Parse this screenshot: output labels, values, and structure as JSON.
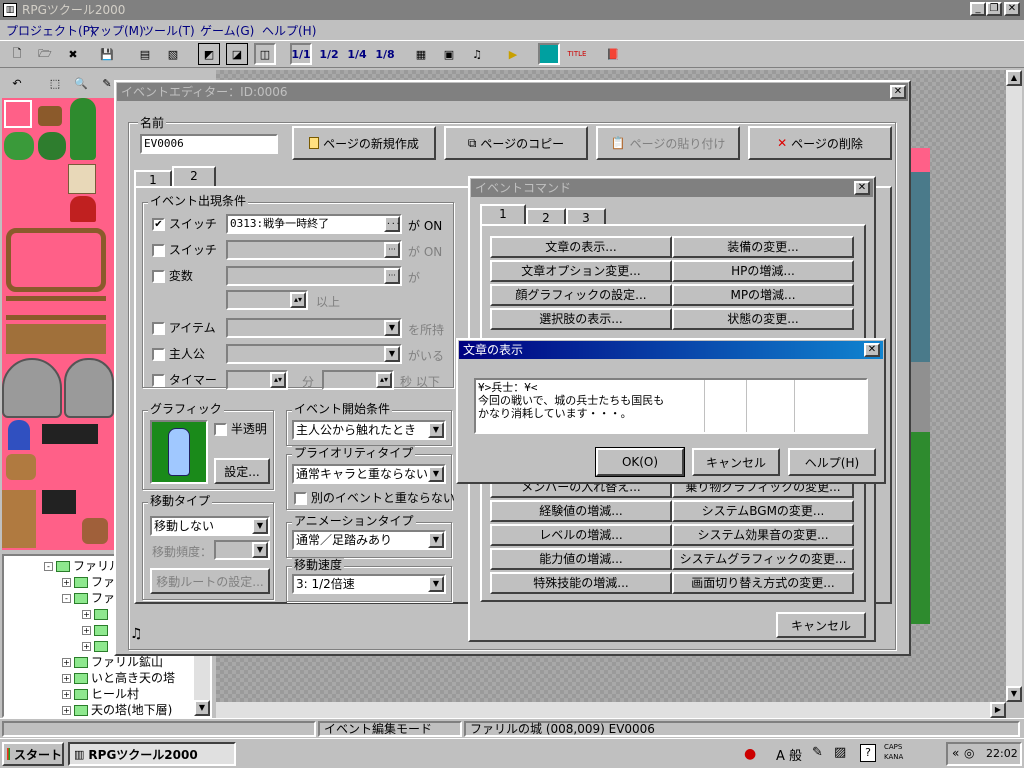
{
  "app": {
    "title": "RPGツクール2000",
    "menu": [
      "プロジェクト(P)",
      "マップ(M)",
      "ツール(T)",
      "ゲーム(G)",
      "ヘルプ(H)"
    ],
    "layer_buttons": [
      "1/1",
      "1/2",
      "1/4",
      "1/8"
    ]
  },
  "event_editor": {
    "title": "イベントエディター：ID:0006",
    "name_label": "名前",
    "name_value": "EV0006",
    "buttons": {
      "new_page": "ページの新規作成",
      "copy_page": "ページのコピー",
      "paste_page": "ページの貼り付け",
      "delete_page": "ページの削除"
    },
    "page_tabs": [
      "1",
      "2"
    ],
    "conditions": {
      "legend": "イベント出現条件",
      "switch1_label": "スイッチ",
      "switch1_value": "0313:戦争一時終了",
      "switch1_suffix": "が ON",
      "switch2_label": "スイッチ",
      "switch2_suffix": "が ON",
      "variable_label": "変数",
      "variable_suffix": "が",
      "variable_more": "以上",
      "item_label": "アイテム",
      "item_suffix": "を所持",
      "hero_label": "主人公",
      "hero_suffix": "がいる",
      "timer_label": "タイマー",
      "timer_min": "分",
      "timer_sec": "秒 以下"
    },
    "graphic": {
      "legend": "グラフィック",
      "semi_transparent": "半透明",
      "settings_button": "設定..."
    },
    "move_type": {
      "legend": "移動タイプ",
      "value": "移動しない",
      "freq_label": "移動頻度：",
      "route_button": "移動ルートの設定..."
    },
    "trigger": {
      "legend": "イベント開始条件",
      "value": "主人公から触れたとき"
    },
    "priority": {
      "legend": "プライオリティタイプ",
      "value": "通常キャラと重ならない",
      "no_overlap": "別のイベントと重ならない"
    },
    "animation": {
      "legend": "アニメーションタイプ",
      "value": "通常／足踏みあり"
    },
    "speed": {
      "legend": "移動速度",
      "value": "3: 1/2倍速"
    }
  },
  "command_window": {
    "title": "イベントコマンド",
    "tabs": [
      "1",
      "2",
      "3"
    ],
    "rows": [
      [
        "文章の表示...",
        "装備の変更..."
      ],
      [
        "文章オプション変更...",
        "HPの増減..."
      ],
      [
        "顔グラフィックの設定...",
        "MPの増減..."
      ],
      [
        "選択肢の表示...",
        "状態の変更..."
      ],
      [
        "メンバーの入れ替え...",
        "乗り物グラフィックの変更..."
      ],
      [
        "経験値の増減...",
        "システムBGMの変更..."
      ],
      [
        "レベルの増減...",
        "システム効果音の変更..."
      ],
      [
        "能力値の増減...",
        "システムグラフィックの変更..."
      ],
      [
        "特殊技能の増減...",
        "画面切り替え方式の変更..."
      ]
    ],
    "cancel": "キャンセル"
  },
  "message_dialog": {
    "title": "文章の表示",
    "lines": [
      "¥>兵士：¥<",
      "今回の戦いで、城の兵士たちも国民も",
      "かなり消耗しています・・・。"
    ],
    "ok": "OK(O)",
    "cancel": "キャンセル",
    "help": "ヘルプ(H)"
  },
  "tree": {
    "rows": [
      {
        "label": "ファリル",
        "indent": 2,
        "pm": "-"
      },
      {
        "label": "ファ",
        "indent": 3,
        "pm": "+"
      },
      {
        "label": "ファ",
        "indent": 3,
        "pm": "-"
      },
      {
        "label": "",
        "indent": 4,
        "pm": "+"
      },
      {
        "label": "",
        "indent": 4,
        "pm": "+"
      },
      {
        "label": "",
        "indent": 4,
        "pm": "+"
      },
      {
        "label": "ファリル鉱山",
        "indent": 3,
        "pm": "+"
      },
      {
        "label": "いと高き天の塔",
        "indent": 3,
        "pm": "+"
      },
      {
        "label": "ヒール村",
        "indent": 3,
        "pm": "+"
      },
      {
        "label": "天の塔(地下層)",
        "indent": 3,
        "pm": "+"
      }
    ]
  },
  "statusbar": {
    "mode": "イベント編集モード",
    "location": "ファリルの城 (008,009) EV0006"
  },
  "taskbar": {
    "start": "スタート",
    "task": "RPGツクール2000",
    "ime": "A 般",
    "caps": "CAPS",
    "kana": "KANA",
    "clock": "22:02"
  },
  "colors": {
    "face": "#c0c0c0",
    "active_title": "#000080",
    "inactive_title": "#808080",
    "tile_pink": "#ff6088",
    "map_check": "#a8a8a8"
  }
}
